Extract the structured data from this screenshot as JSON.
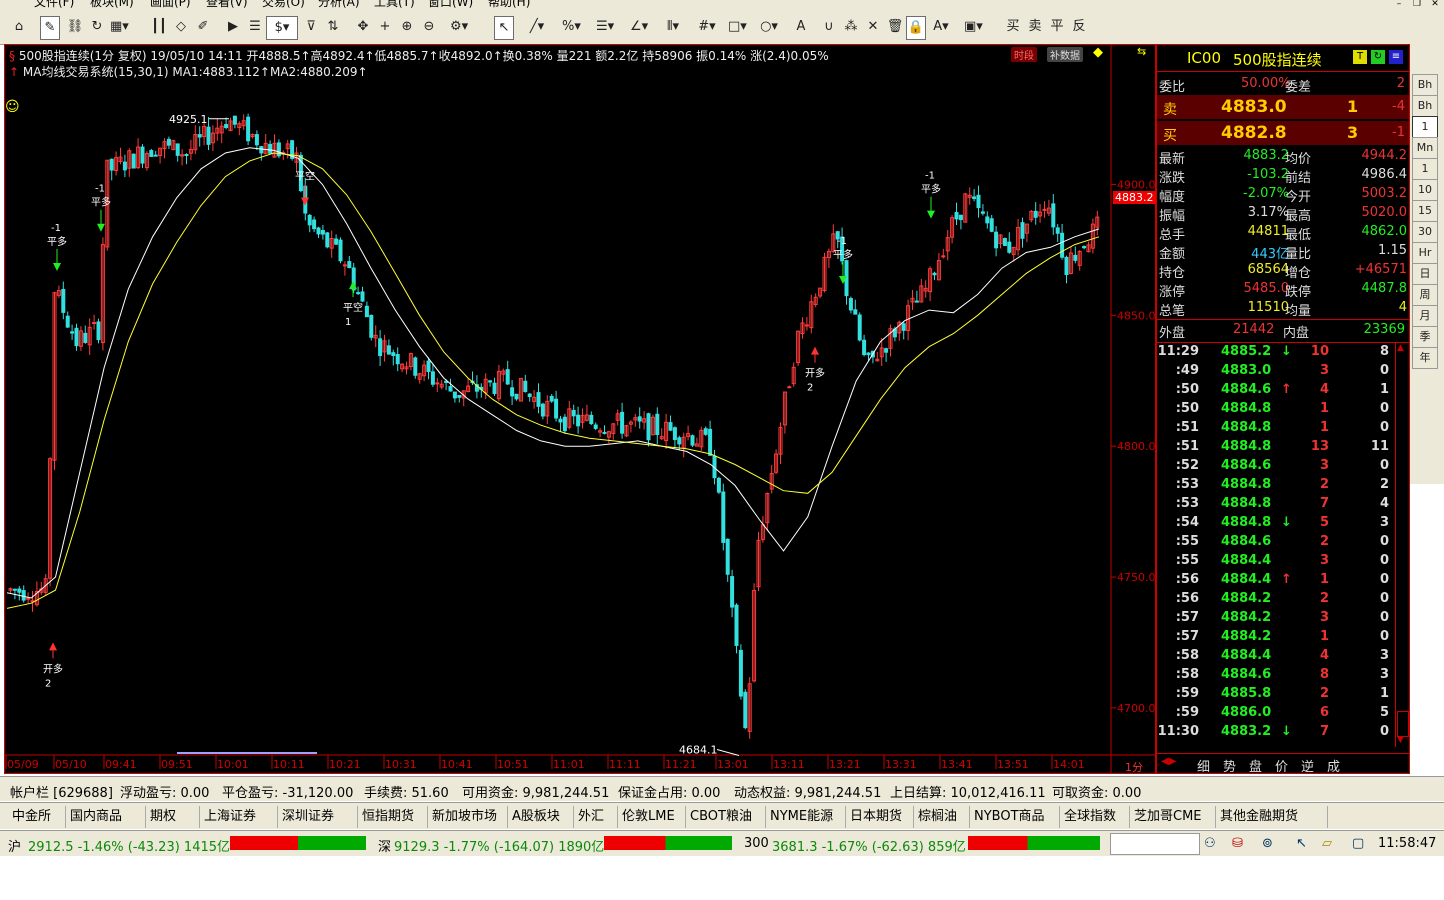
{
  "menu": [
    "文件(F)",
    "板块(M)",
    "画面(P)",
    "查看(V)",
    "交易(O)",
    "分析(A)",
    "工具(T)",
    "窗口(W)",
    "帮助(H)"
  ],
  "toolbar": {
    "right_chars": [
      "买",
      "卖",
      "平",
      "反"
    ]
  },
  "chart": {
    "header_line1": "500股指连续(1分 复权) 19/05/10 14:11 开4888.5↑高4892.4↑低4885.7↑收4892.0↑换0.38% 量221 额2.2亿 持58906 振0.14% 涨(2.4)0.05%",
    "header_line2": "MA均线交易系统(15,30,1) MA1:4883.112↑MA2:4880.209↑",
    "btn_shiduan": "时段",
    "btn_bushuju": "补数据",
    "price_high_label": "4925.1",
    "price_low_label": "4684.1",
    "current_price_tag": "4883.2",
    "y_labels": [
      "4900.0",
      "4850.0",
      "4800.0",
      "4750.0",
      "4700.0"
    ],
    "x_labels": [
      "05/09",
      "05/10",
      "09:41",
      "09:51",
      "10:01",
      "10:11",
      "10:21",
      "10:31",
      "10:41",
      "10:51",
      "11:01",
      "11:11",
      "11:21",
      "13:01",
      "13:11",
      "13:21",
      "13:31",
      "13:41",
      "13:51",
      "14:01"
    ],
    "period_label": "1分",
    "signals": [
      {
        "text": "开多",
        "sub": "2"
      },
      {
        "text": "平多",
        "sub": "-1"
      },
      {
        "text": "平多",
        "sub": "-1"
      },
      {
        "text": "平空",
        "sub": ""
      },
      {
        "text": "平空",
        "sub": "1"
      },
      {
        "text": "开多",
        "sub": "2"
      },
      {
        "text": "平多",
        "sub": "-1"
      },
      {
        "text": "平多",
        "sub": "-1"
      }
    ]
  },
  "chart_data": {
    "type": "candlestick",
    "ylim": [
      4682,
      4938
    ],
    "series": [
      {
        "name": "MA1",
        "values": [
          4744,
          4742,
          4750,
          4790,
          4830,
          4860,
          4880,
          4895,
          4906,
          4912,
          4914,
          4913,
          4910,
          4900,
          4885,
          4868,
          4852,
          4838,
          4826,
          4818,
          4812,
          4806,
          4802,
          4800,
          4800,
          4801,
          4802,
          4800,
          4798,
          4793,
          4785,
          4772,
          4760,
          4773,
          4800,
          4825,
          4840,
          4848,
          4852,
          4851,
          4858,
          4868,
          4874,
          4876,
          4880,
          4883
        ]
      },
      {
        "name": "MA2",
        "values": [
          4738,
          4740,
          4745,
          4775,
          4810,
          4840,
          4862,
          4878,
          4892,
          4903,
          4909,
          4912,
          4911,
          4906,
          4896,
          4882,
          4866,
          4850,
          4836,
          4826,
          4818,
          4812,
          4808,
          4805,
          4803,
          4802,
          4801,
          4800,
          4799,
          4797,
          4793,
          4788,
          4783,
          4782,
          4790,
          4804,
          4818,
          4830,
          4838,
          4843,
          4850,
          4858,
          4866,
          4872,
          4877,
          4880
        ]
      }
    ],
    "high": 4925.1,
    "low": 4684.1
  },
  "quote": {
    "title_code": "IC00",
    "title_name": "500股指连续",
    "weibi_label": "委比",
    "weibi": "50.00%",
    "weicha_label": "委差",
    "weicha": "2",
    "sell_label": "卖",
    "sell_price": "4883.0",
    "sell_vol": "1",
    "sell_chg": "-4",
    "buy_label": "买",
    "buy_price": "4882.8",
    "buy_vol": "3",
    "buy_chg": "-1",
    "rows": [
      {
        "l1": "最新",
        "v1": "4883.2",
        "l2": "均价",
        "v2": "4944.2",
        "c1": "g",
        "c2": "r"
      },
      {
        "l1": "涨跌",
        "v1": "-103.2",
        "l2": "前结",
        "v2": "4986.4",
        "c1": "g",
        "c2": "w"
      },
      {
        "l1": "幅度",
        "v1": "-2.07%",
        "l2": "今开",
        "v2": "5003.2",
        "c1": "g",
        "c2": "r"
      },
      {
        "l1": "振幅",
        "v1": "3.17%",
        "l2": "最高",
        "v2": "5020.0",
        "c1": "w",
        "c2": "r"
      },
      {
        "l1": "总手",
        "v1": "44811",
        "l2": "最低",
        "v2": "4862.0",
        "c1": "y",
        "c2": "g"
      },
      {
        "l1": "金额",
        "v1": "443亿",
        "l2": "量比",
        "v2": "1.15",
        "c1": "c",
        "c2": "w"
      },
      {
        "l1": "持仓",
        "v1": "68564",
        "l2": "增仓",
        "v2": "+46571",
        "c1": "y",
        "c2": "r"
      },
      {
        "l1": "涨停",
        "v1": "5485.0",
        "l2": "跌停",
        "v2": "4487.8",
        "c1": "r",
        "c2": "g"
      },
      {
        "l1": "总笔",
        "v1": "11510",
        "l2": "均量",
        "v2": "4",
        "c1": "y",
        "c2": "y"
      }
    ],
    "outer_label": "外盘",
    "outer": "21442",
    "inner_label": "内盘",
    "inner": "23369",
    "ticks": [
      {
        "t": "11:29",
        "p": "4885.2",
        "a": "↓",
        "v": "10",
        "d": "8"
      },
      {
        "t": ":49",
        "p": "4883.0",
        "a": "",
        "v": "3",
        "d": "0"
      },
      {
        "t": ":50",
        "p": "4884.6",
        "a": "↑",
        "v": "4",
        "d": "1"
      },
      {
        "t": ":50",
        "p": "4884.8",
        "a": "",
        "v": "1",
        "d": "0"
      },
      {
        "t": ":51",
        "p": "4884.8",
        "a": "",
        "v": "1",
        "d": "0"
      },
      {
        "t": ":51",
        "p": "4884.8",
        "a": "",
        "v": "13",
        "d": "11"
      },
      {
        "t": ":52",
        "p": "4884.6",
        "a": "",
        "v": "3",
        "d": "0"
      },
      {
        "t": ":53",
        "p": "4884.8",
        "a": "",
        "v": "2",
        "d": "2"
      },
      {
        "t": ":53",
        "p": "4884.8",
        "a": "",
        "v": "7",
        "d": "4"
      },
      {
        "t": ":54",
        "p": "4884.8",
        "a": "↓",
        "v": "5",
        "d": "3"
      },
      {
        "t": ":55",
        "p": "4884.6",
        "a": "",
        "v": "2",
        "d": "0"
      },
      {
        "t": ":55",
        "p": "4884.4",
        "a": "",
        "v": "3",
        "d": "0"
      },
      {
        "t": ":56",
        "p": "4884.4",
        "a": "↑",
        "v": "1",
        "d": "0"
      },
      {
        "t": ":56",
        "p": "4884.2",
        "a": "",
        "v": "2",
        "d": "0"
      },
      {
        "t": ":57",
        "p": "4884.2",
        "a": "",
        "v": "3",
        "d": "0"
      },
      {
        "t": ":57",
        "p": "4884.2",
        "a": "",
        "v": "1",
        "d": "0"
      },
      {
        "t": ":58",
        "p": "4884.4",
        "a": "",
        "v": "4",
        "d": "3"
      },
      {
        "t": ":58",
        "p": "4884.6",
        "a": "",
        "v": "8",
        "d": "3"
      },
      {
        "t": ":59",
        "p": "4885.8",
        "a": "",
        "v": "2",
        "d": "1"
      },
      {
        "t": ":59",
        "p": "4886.0",
        "a": "",
        "v": "6",
        "d": "5"
      },
      {
        "t": "11:30",
        "p": "4883.2",
        "a": "↓",
        "v": "7",
        "d": "0"
      }
    ],
    "bottom_tabs": [
      "细",
      "势",
      "盘",
      "价",
      "逆",
      "成"
    ]
  },
  "right_tabs": [
    "Bh",
    "Bh",
    "1",
    "Mn",
    "1",
    "10",
    "15",
    "30",
    "Hr",
    "日",
    "周",
    "月",
    "季",
    "年"
  ],
  "account": {
    "a1": "帐户栏 [629688]",
    "a2": "浮动盈亏: 0.00",
    "a3": "平仓盈亏: -31,120.00",
    "a4": "手续费: 51.60",
    "a5": "可用资金: 9,981,244.51",
    "a6": "保证金占用: 0.00",
    "a7": "动态权益: 9,981,244.51",
    "a8": "上日结算: 10,012,416.11",
    "a9": "可取资金: 0.00"
  },
  "market_tabs": [
    "中金所",
    "国内商品",
    "期权",
    "上海证券",
    "深圳证券",
    "恒指期货",
    "新加坡市场",
    "A股板块",
    "外汇",
    "伦敦LME",
    "CBOT粮油",
    "NYME能源",
    "日本期货",
    "棕榈油",
    "NYBOT商品",
    "全球指数",
    "芝加哥CME",
    "其他金融期货"
  ],
  "ticker": {
    "sh_label": "沪",
    "sh": "2912.5 -1.46% (-43.23) 1415亿",
    "sz_label": "深",
    "sz": "9129.3 -1.77% (-164.07) 1890亿",
    "hs_label": "300",
    "hs": "3681.3 -1.67% (-62.63) 859亿",
    "time": "11:58:47"
  },
  "colors": {
    "up": "#ff3b3b",
    "down": "#33e0e0",
    "ma1": "#ffffff",
    "ma2": "#ffff33",
    "grid_red": "#c00000"
  }
}
